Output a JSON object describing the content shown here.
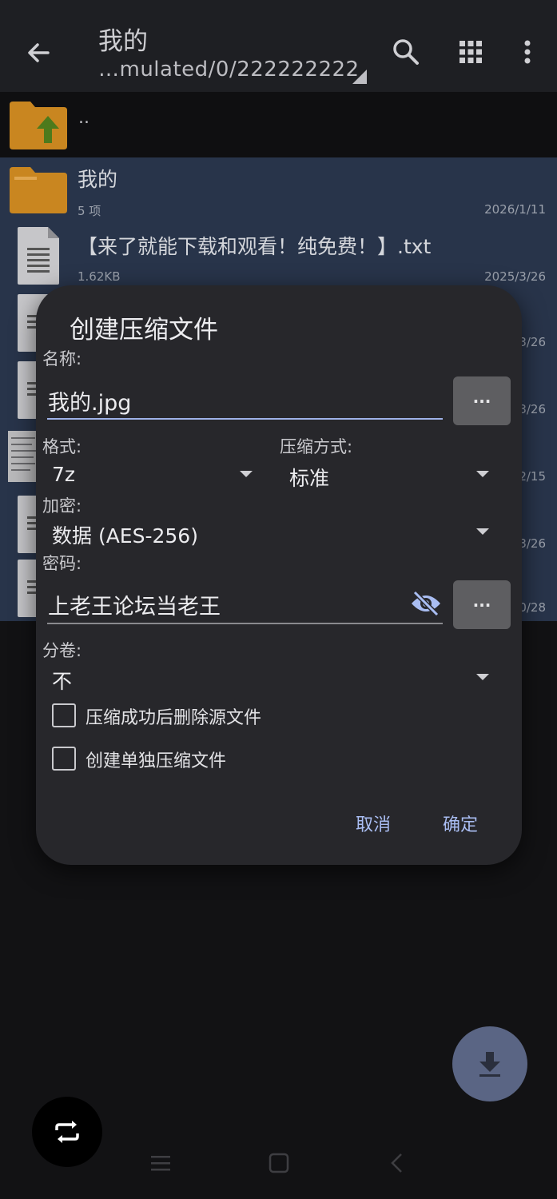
{
  "appbar": {
    "title": "我的",
    "path": "…mulated/0/222222222",
    "back_icon": "arrow-left-icon",
    "search_icon": "search-icon",
    "grid_icon": "grid-view-icon",
    "menu_icon": "more-vert-icon"
  },
  "updir": {
    "label": ".."
  },
  "files": [
    {
      "name": "我的",
      "meta": "5 项",
      "date": "2026/1/11",
      "icon": "folder"
    },
    {
      "name": "【来了就能下载和观看！纯免费！】.txt",
      "meta": "1.62KB",
      "date": "2025/3/26",
      "icon": "doc"
    },
    {
      "name": "",
      "meta": "",
      "date": "3/26",
      "icon": "doc"
    },
    {
      "name": "",
      "meta": "",
      "date": "3/26",
      "icon": "doc"
    },
    {
      "name": "",
      "meta": "",
      "date": "2/15",
      "icon": "image"
    },
    {
      "name": "",
      "meta": "",
      "date": "3/26",
      "icon": "doc"
    },
    {
      "name": "",
      "meta": "",
      "date": "0/28",
      "icon": "doc"
    }
  ],
  "dialog": {
    "title": "创建压缩文件",
    "name_label": "名称:",
    "name_value": "我的.jpg",
    "browse_label": "...",
    "format_label": "格式:",
    "format_value": "7z",
    "method_label": "压缩方式:",
    "method_value": "标准",
    "encrypt_label": "加密:",
    "encrypt_value": "数据 (AES-256)",
    "password_label": "密码:",
    "password_value": "上老王论坛当老王",
    "password_more": "...",
    "split_label": "分卷:",
    "split_value": "不",
    "checkbox_delete": "压缩成功后删除源文件",
    "checkbox_separate": "创建单独压缩文件",
    "cancel": "取消",
    "ok": "确定"
  },
  "colors": {
    "accent": "#9fb2e8",
    "list_selected_bg": "#28344a",
    "dialog_bg": "#27272b",
    "folder": "#d08a1e"
  }
}
